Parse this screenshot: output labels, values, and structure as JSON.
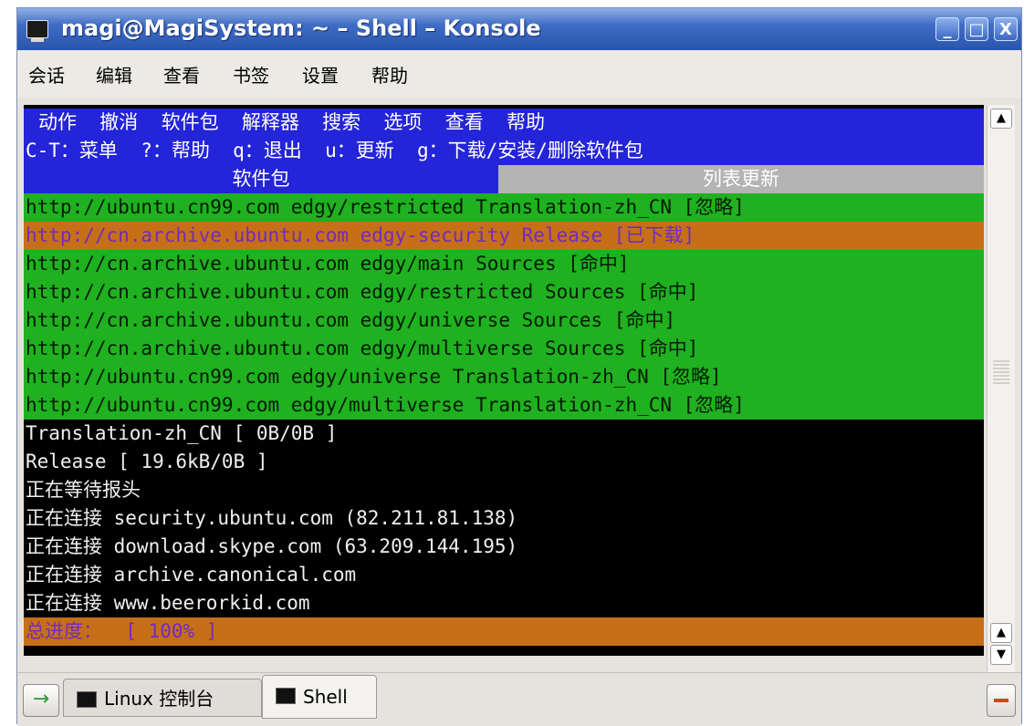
{
  "window": {
    "title": "magi@MagiSystem: ~ – Shell – Konsole",
    "buttons": {
      "minimize": "_",
      "maximize": "□",
      "close": "X"
    }
  },
  "menubar": [
    "会话",
    "编辑",
    "查看",
    "书签",
    "设置",
    "帮助"
  ],
  "terminal": {
    "menu_line": "动作  撤消  软件包  解释器  搜索  选项  查看  帮助",
    "shortcut_line": "C-T：菜单  ?：帮助  q：退出  u：更新  g：下载/安装/删除软件包",
    "tabs": {
      "left": "软件包",
      "right": "列表更新"
    },
    "sources": [
      {
        "status": "green",
        "text": "http://ubuntu.cn99.com edgy/restricted Translation-zh_CN [忽略]"
      },
      {
        "status": "orange",
        "text": "http://cn.archive.ubuntu.com edgy-security Release [已下载]"
      },
      {
        "status": "green",
        "text": "http://cn.archive.ubuntu.com edgy/main Sources [命中]"
      },
      {
        "status": "green",
        "text": "http://cn.archive.ubuntu.com edgy/restricted Sources [命中]"
      },
      {
        "status": "green",
        "text": "http://cn.archive.ubuntu.com edgy/universe Sources [命中]"
      },
      {
        "status": "green",
        "text": "http://cn.archive.ubuntu.com edgy/multiverse Sources [命中]"
      },
      {
        "status": "green",
        "text": "http://ubuntu.cn99.com edgy/universe Translation-zh_CN [忽略]"
      },
      {
        "status": "green",
        "text": "http://ubuntu.cn99.com edgy/multiverse Translation-zh_CN [忽略]"
      }
    ],
    "log": [
      "Translation-zh_CN [ 0B/0B ]",
      "Release [ 19.6kB/0B ]",
      "正在等待报头",
      "正在连接 security.ubuntu.com (82.211.81.138)",
      "正在连接 download.skype.com (63.209.144.195)",
      "正在连接 archive.canonical.com",
      "正在连接 www.beerorkid.com"
    ],
    "progress": "总进度：  [ 100% ]",
    "progress_percent": 100
  },
  "scrollbar": {
    "up": "▲",
    "down": "▼"
  },
  "tabbar": {
    "new_tab_icon": "→",
    "tabs": [
      {
        "label": "Linux 控制台",
        "active": false
      },
      {
        "label": "Shell",
        "active": true
      }
    ]
  },
  "colors": {
    "blue_bar": "#2424d8",
    "green_row": "#1fb11f",
    "orange_row": "#c76f18",
    "grey_tab": "#b4b4b4"
  }
}
